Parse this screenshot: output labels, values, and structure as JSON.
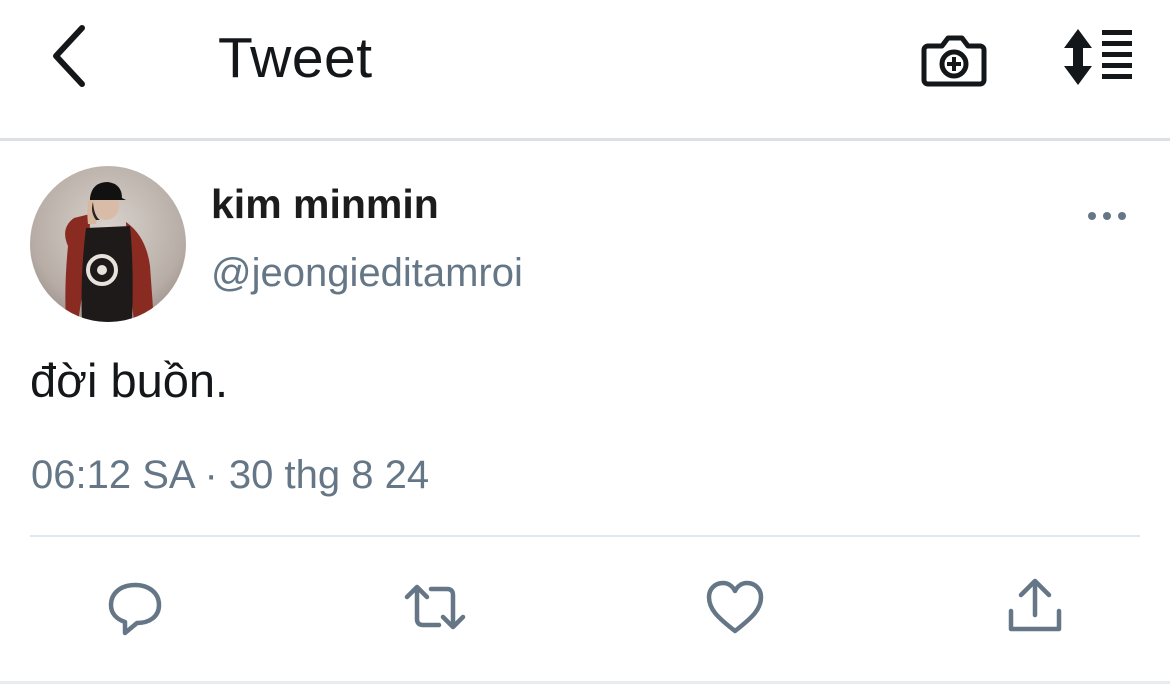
{
  "header": {
    "title": "Tweet",
    "back_icon": "chevron-left-icon",
    "camera_icon": "camera-plus-icon",
    "sort_icon": "sort-list-icon"
  },
  "tweet": {
    "author": {
      "display_name": "kim minmin",
      "handle": "@jeongieditamroi",
      "avatar": "avatar-photo"
    },
    "text": "đời buồn.",
    "timestamp": "06:12 SA · 30 thg 8 24",
    "more_icon": "more-horizontal-icon"
  },
  "actions": [
    {
      "name": "reply",
      "icon": "reply-icon"
    },
    {
      "name": "retweet",
      "icon": "retweet-icon"
    },
    {
      "name": "like",
      "icon": "heart-icon"
    },
    {
      "name": "share",
      "icon": "share-icon"
    }
  ],
  "colors": {
    "text": "#14171a",
    "secondary_text": "#657786",
    "icon_gray": "#657786",
    "divider": "#e1e8ed"
  }
}
